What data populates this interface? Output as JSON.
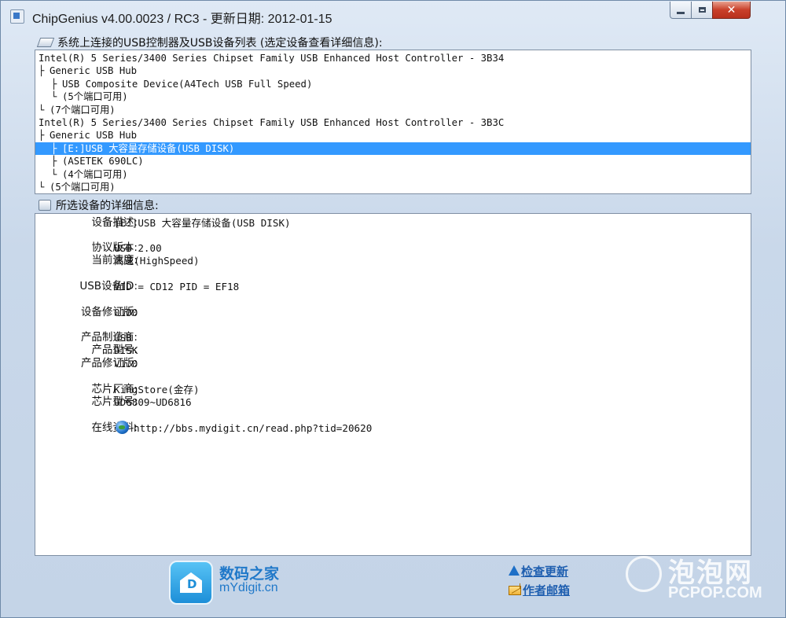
{
  "window": {
    "title": "ChipGenius v4.00.0023 / RC3 - 更新日期: 2012-01-15",
    "controls": {
      "minimize": "minimize",
      "maximize": "maximize",
      "close": "✕"
    }
  },
  "device_list": {
    "label": "系统上连接的USB控制器及USB设备列表 (选定设备查看详细信息):",
    "rows": [
      {
        "text": "Intel(R) 5 Series/3400 Series Chipset Family USB Enhanced Host Controller - 3B34",
        "level": 0,
        "conn": "",
        "selected": false
      },
      {
        "text": "Generic USB Hub",
        "level": 1,
        "conn": "├",
        "selected": false
      },
      {
        "text": "USB Composite Device(A4Tech USB Full Speed)",
        "level": 2,
        "conn": "├",
        "selected": false
      },
      {
        "text": "(5个端口可用)",
        "level": 2,
        "conn": "└",
        "selected": false
      },
      {
        "text": "(7个端口可用)",
        "level": 1,
        "conn": "└",
        "selected": false
      },
      {
        "text": "Intel(R) 5 Series/3400 Series Chipset Family USB Enhanced Host Controller - 3B3C",
        "level": 0,
        "conn": "",
        "selected": false
      },
      {
        "text": "Generic USB Hub",
        "level": 1,
        "conn": "├",
        "selected": false
      },
      {
        "text": "[E:]USB 大容量存储设备(USB DISK)",
        "level": 2,
        "conn": "├",
        "selected": true
      },
      {
        "text": "(ASETEK 690LC)",
        "level": 2,
        "conn": "├",
        "selected": false
      },
      {
        "text": "(4个端口可用)",
        "level": 2,
        "conn": "└",
        "selected": false
      },
      {
        "text": "(5个端口可用)",
        "level": 1,
        "conn": "└",
        "selected": false
      }
    ]
  },
  "details": {
    "label": "所选设备的详细信息:",
    "rows": [
      {
        "label": "设备描述:",
        "value": "[E:]USB 大容量存储设备(USB DISK)"
      },
      {
        "label": "协议版本:",
        "value": "USB 2.00"
      },
      {
        "label": "当前速度:",
        "value": "高速(HighSpeed)"
      },
      {
        "label": "USB设备ID:",
        "value": "VID = CD12 PID = EF18"
      },
      {
        "label": "设备修订版:",
        "value": "0100"
      },
      {
        "label": "产品制造商:",
        "value": "USB"
      },
      {
        "label": "产品型号:",
        "value": "DISK"
      },
      {
        "label": "产品修订版:",
        "value": "V1.0"
      },
      {
        "label": "芯片厂商:",
        "value": "KingStore(金存)"
      },
      {
        "label": "芯片型号:",
        "value": "UD6809~UD6816"
      },
      {
        "label": "在线资料:",
        "value": "http://bbs.mydigit.cn/read.php?tid=20620",
        "link": true
      }
    ]
  },
  "footer": {
    "brand_cn": "数码之家",
    "brand_en": "mYdigit.cn",
    "check_update": "检查更新",
    "author_mail": "作者邮箱"
  },
  "watermark": {
    "cn": "泡泡网",
    "en": "PCPOP.COM"
  },
  "icons": {
    "list_label": "usb-device-icon",
    "detail_label": "details-icon",
    "online": "globe-icon",
    "update": "arrow-up-icon",
    "mail": "mail-icon"
  },
  "colors": {
    "selection": "#3399ff",
    "brand": "#1f78c9",
    "link": "#1f5fb0"
  }
}
